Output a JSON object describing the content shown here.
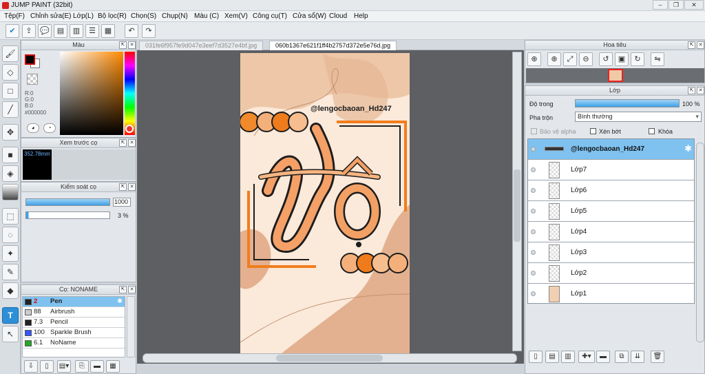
{
  "app": {
    "title": "JUMP PAINT (32bit)"
  },
  "menu": [
    "Tệp(F)",
    "Chỉnh sửa(E)",
    "Lớp(L)",
    "Bộ lọc(R)",
    "Chọn(S)",
    "Chụp(N)",
    "Màu (C)",
    "Xem(V)",
    "Công cụ(T)",
    "Cửa sổ(W)",
    "Cloud",
    "Help"
  ],
  "tabs": [
    "031fe6f957fe9d047e3eef7d3527e4bf.jpg",
    "060b1367e621f1ff4b2757d372e5e76d.jpg"
  ],
  "color_panel": {
    "title": "Màu",
    "r": "R:0",
    "g": "G:0",
    "b": "B:0",
    "hex": "#000000"
  },
  "brush_preview": {
    "title": "Xem trước cọ",
    "size": "352.78mm"
  },
  "brush_control": {
    "title": "Kiểm soát cọ",
    "size_value": "1000",
    "opacity_value": "3 %"
  },
  "brushes": {
    "title": "Cọ: NONAME",
    "items": [
      {
        "size": "2",
        "name": "Pen",
        "color": "#222222"
      },
      {
        "size": "88",
        "name": "Airbrush",
        "color": "#cccccc"
      },
      {
        "size": "7.3",
        "name": "Pencil",
        "color": "#222222"
      },
      {
        "size": "100",
        "name": "Sparkle Brush",
        "color": "#3355ff"
      },
      {
        "size": "6.1",
        "name": "NoName",
        "color": "#22aa22"
      }
    ]
  },
  "navigator": {
    "title": "Hoa tiêu"
  },
  "layers": {
    "title": "Lớp",
    "opacity_label": "Độ trong",
    "opacity_value": "100 %",
    "blend_label": "Pha trộn",
    "blend_value": "Bình thường",
    "protect_alpha": "Bảo vệ alpha",
    "clip": "Xén bớt",
    "lock": "Khóa",
    "items": [
      "@lengocbaoan_Hd247",
      "Lớp7",
      "Lớp6",
      "Lớp5",
      "Lớp4",
      "Lớp3",
      "Lớp2",
      "Lớp1"
    ]
  },
  "artwork": {
    "handle": "@lengocbaoan_Hd247"
  }
}
